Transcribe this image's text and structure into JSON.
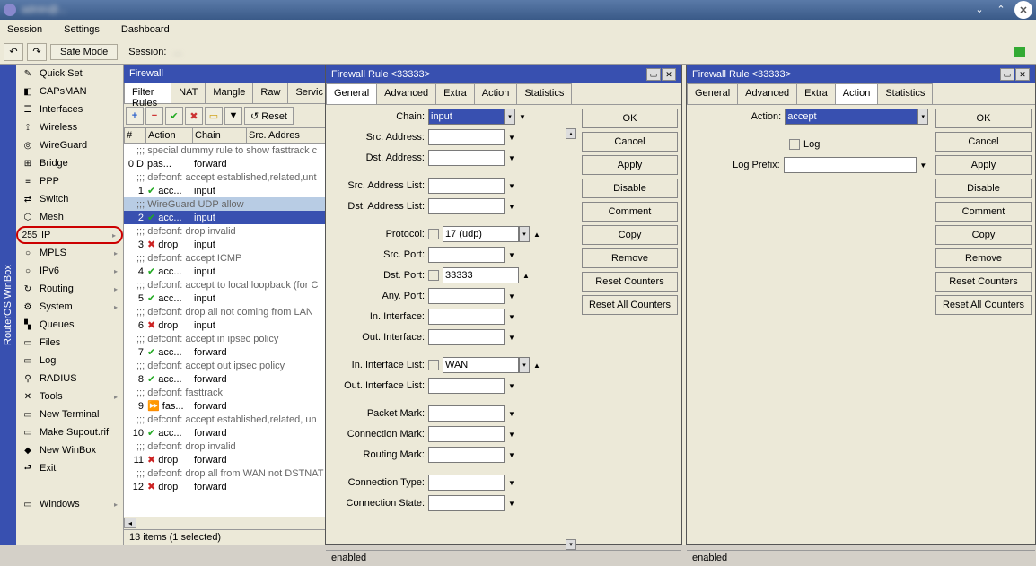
{
  "titlebar": {
    "title": "admin@..."
  },
  "menubar": [
    "Session",
    "Settings",
    "Dashboard"
  ],
  "toolbar": {
    "safemode": "Safe Mode",
    "session_lbl": "Session:",
    "session_val": "..."
  },
  "sidebar": {
    "items": [
      {
        "icon": "✎",
        "label": "Quick Set"
      },
      {
        "icon": "◧",
        "label": "CAPsMAN"
      },
      {
        "icon": "☰",
        "label": "Interfaces"
      },
      {
        "icon": "⟟",
        "label": "Wireless"
      },
      {
        "icon": "◎",
        "label": "WireGuard"
      },
      {
        "icon": "⊞",
        "label": "Bridge"
      },
      {
        "icon": "≡",
        "label": "PPP"
      },
      {
        "icon": "⇄",
        "label": "Switch"
      },
      {
        "icon": "⬡",
        "label": "Mesh"
      },
      {
        "icon": "255",
        "label": "IP",
        "hl": true,
        "arrow": true
      },
      {
        "icon": "○",
        "label": "MPLS",
        "arrow": true
      },
      {
        "icon": "○",
        "label": "IPv6",
        "arrow": true
      },
      {
        "icon": "↻",
        "label": "Routing",
        "arrow": true
      },
      {
        "icon": "⚙",
        "label": "System",
        "arrow": true
      },
      {
        "icon": "▚",
        "label": "Queues"
      },
      {
        "icon": "▭",
        "label": "Files"
      },
      {
        "icon": "▭",
        "label": "Log"
      },
      {
        "icon": "⚲",
        "label": "RADIUS"
      },
      {
        "icon": "✕",
        "label": "Tools",
        "arrow": true
      },
      {
        "icon": "▭",
        "label": "New Terminal"
      },
      {
        "icon": "▭",
        "label": "Make Supout.rif"
      },
      {
        "icon": "◆",
        "label": "New WinBox"
      },
      {
        "icon": "⮐",
        "label": "Exit"
      },
      {
        "icon": "▭",
        "label": "Windows",
        "arrow": true
      }
    ]
  },
  "vtext": "RouterOS WinBox",
  "firewall": {
    "title": "Firewall",
    "tabs": [
      "Filter Rules",
      "NAT",
      "Mangle",
      "Raw",
      "Servic"
    ],
    "reset_btn": "↺ Reset",
    "headers": [
      "#",
      "Action",
      "Chain",
      "Src. Addres"
    ],
    "rows": [
      {
        "c": ";;; special dummy rule to show fasttrack c"
      },
      {
        "n": "0",
        "f": "D",
        "a": "pas...",
        "ch": "forward"
      },
      {
        "c": ";;; defconf: accept established,related,unt"
      },
      {
        "n": "1",
        "a": "acc...",
        "ch": "input",
        "ico": "g"
      },
      {
        "c": ";;; WireGuard UDP allow",
        "sel": 1
      },
      {
        "n": "2",
        "a": "acc...",
        "ch": "input",
        "ico": "g",
        "sel": 2
      },
      {
        "c": ";;; defconf: drop invalid"
      },
      {
        "n": "3",
        "a": "drop",
        "ch": "input",
        "ico": "r"
      },
      {
        "c": ";;; defconf: accept ICMP"
      },
      {
        "n": "4",
        "a": "acc...",
        "ch": "input",
        "ico": "g"
      },
      {
        "c": ";;; defconf: accept to local loopback (for C"
      },
      {
        "n": "5",
        "a": "acc...",
        "ch": "input",
        "ico": "g"
      },
      {
        "c": ";;; defconf: drop all not coming from LAN"
      },
      {
        "n": "6",
        "a": "drop",
        "ch": "input",
        "ico": "r"
      },
      {
        "c": ";;; defconf: accept in ipsec policy"
      },
      {
        "n": "7",
        "a": "acc...",
        "ch": "forward",
        "ico": "g"
      },
      {
        "c": ";;; defconf: accept out ipsec policy"
      },
      {
        "n": "8",
        "a": "acc...",
        "ch": "forward",
        "ico": "g"
      },
      {
        "c": ";;; defconf: fasttrack"
      },
      {
        "n": "9",
        "a": "fas...",
        "ch": "forward",
        "ico": "b"
      },
      {
        "c": ";;; defconf: accept established,related, un"
      },
      {
        "n": "10",
        "a": "acc...",
        "ch": "forward",
        "ico": "g"
      },
      {
        "c": ";;; defconf: drop invalid"
      },
      {
        "n": "11",
        "a": "drop",
        "ch": "forward",
        "ico": "r"
      },
      {
        "c": ";;; defconf: drop all from WAN not DSTNAT"
      },
      {
        "n": "12",
        "a": "drop",
        "ch": "forward",
        "ico": "r"
      }
    ],
    "status": "13 items (1 selected)"
  },
  "dlg1": {
    "title": "Firewall Rule <33333>",
    "tabs": [
      "General",
      "Advanced",
      "Extra",
      "Action",
      "Statistics"
    ],
    "active_tab": 0,
    "fields": [
      {
        "lbl": "Chain:",
        "val": "input",
        "dd": 1,
        "sel": 1,
        "exp": "▼"
      },
      {
        "lbl": "Src. Address:",
        "exp": "▼"
      },
      {
        "lbl": "Dst. Address:",
        "exp": "▼"
      },
      {
        "gap": 1
      },
      {
        "lbl": "Src. Address List:",
        "exp": "▼"
      },
      {
        "lbl": "Dst. Address List:",
        "exp": "▼"
      },
      {
        "gap": 1
      },
      {
        "lbl": "Protocol:",
        "chk": 1,
        "val": "17 (udp)",
        "dd": 1,
        "exp": "▲"
      },
      {
        "lbl": "Src. Port:",
        "exp": "▼"
      },
      {
        "lbl": "Dst. Port:",
        "chk": 1,
        "val": "33333",
        "exp": "▲"
      },
      {
        "lbl": "Any. Port:",
        "exp": "▼"
      },
      {
        "lbl": "In. Interface:",
        "exp": "▼"
      },
      {
        "lbl": "Out. Interface:",
        "exp": "▼"
      },
      {
        "gap": 1
      },
      {
        "lbl": "In. Interface List:",
        "chk": 1,
        "val": "WAN",
        "dd": 1,
        "exp": "▲"
      },
      {
        "lbl": "Out. Interface List:",
        "exp": "▼"
      },
      {
        "gap": 1
      },
      {
        "lbl": "Packet Mark:",
        "exp": "▼"
      },
      {
        "lbl": "Connection Mark:",
        "exp": "▼"
      },
      {
        "lbl": "Routing Mark:",
        "exp": "▼"
      },
      {
        "gap": 1
      },
      {
        "lbl": "Connection Type:",
        "exp": "▼"
      },
      {
        "lbl": "Connection State:",
        "exp": "▼"
      }
    ],
    "btns": [
      "OK",
      "Cancel",
      "Apply",
      "Disable",
      "Comment",
      "Copy",
      "Remove",
      "Reset Counters",
      "Reset All Counters"
    ],
    "status": "enabled"
  },
  "dlg2": {
    "title": "Firewall Rule <33333>",
    "tabs": [
      "General",
      "Advanced",
      "Extra",
      "Action",
      "Statistics"
    ],
    "active_tab": 3,
    "fields": [
      {
        "lbl": "Action:",
        "val": "accept",
        "dd": 1,
        "sel": 1,
        "wide": 1
      },
      {
        "gap": 1
      },
      {
        "lbl": "",
        "chklbl": "Log"
      },
      {
        "lbl": "Log Prefix:",
        "wide": 1,
        "exp": "▼"
      }
    ],
    "btns": [
      "OK",
      "Cancel",
      "Apply",
      "Disable",
      "Comment",
      "Copy",
      "Remove",
      "Reset Counters",
      "Reset All Counters"
    ],
    "status": "enabled"
  }
}
